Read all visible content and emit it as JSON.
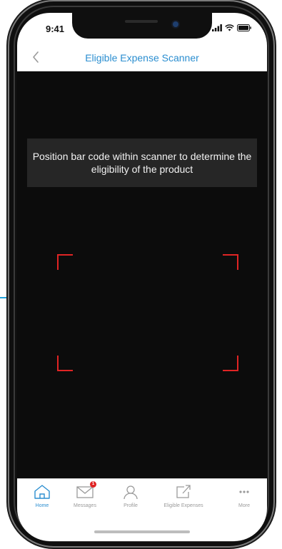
{
  "status_bar": {
    "time": "9:41"
  },
  "nav": {
    "title": "Eligible Expense Scanner",
    "back_icon": "chevron-left-icon"
  },
  "scanner": {
    "instruction": "Position bar code within scanner to determine the eligibility of the product",
    "frame_color": "#e02424"
  },
  "tab_bar": {
    "items": [
      {
        "label": "Home",
        "icon": "home-icon",
        "active": true
      },
      {
        "label": "Messages",
        "icon": "envelope-icon",
        "badge": "1"
      },
      {
        "label": "Profile",
        "icon": "person-icon"
      },
      {
        "label": "Eligible Expenses",
        "icon": "external-link-icon"
      },
      {
        "label": "More",
        "icon": "more-dots-icon"
      }
    ]
  },
  "colors": {
    "accent": "#2b8ed0",
    "callout_line": "#22a3dc",
    "badge": "#e02424"
  }
}
